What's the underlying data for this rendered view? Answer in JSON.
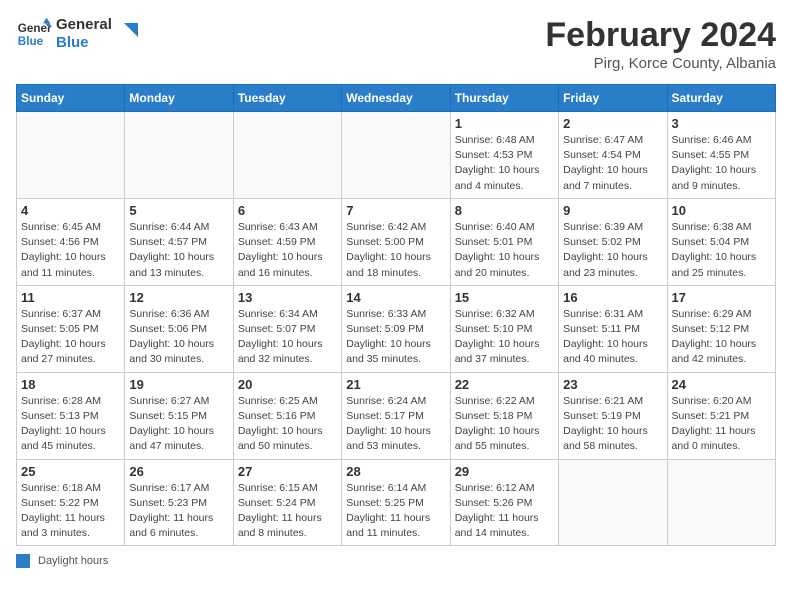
{
  "header": {
    "logo_general": "General",
    "logo_blue": "Blue",
    "month_title": "February 2024",
    "location": "Pirg, Korce County, Albania"
  },
  "weekdays": [
    "Sunday",
    "Monday",
    "Tuesday",
    "Wednesday",
    "Thursday",
    "Friday",
    "Saturday"
  ],
  "weeks": [
    [
      {
        "day": "",
        "info": ""
      },
      {
        "day": "",
        "info": ""
      },
      {
        "day": "",
        "info": ""
      },
      {
        "day": "",
        "info": ""
      },
      {
        "day": "1",
        "info": "Sunrise: 6:48 AM\nSunset: 4:53 PM\nDaylight: 10 hours and 4 minutes."
      },
      {
        "day": "2",
        "info": "Sunrise: 6:47 AM\nSunset: 4:54 PM\nDaylight: 10 hours and 7 minutes."
      },
      {
        "day": "3",
        "info": "Sunrise: 6:46 AM\nSunset: 4:55 PM\nDaylight: 10 hours and 9 minutes."
      }
    ],
    [
      {
        "day": "4",
        "info": "Sunrise: 6:45 AM\nSunset: 4:56 PM\nDaylight: 10 hours and 11 minutes."
      },
      {
        "day": "5",
        "info": "Sunrise: 6:44 AM\nSunset: 4:57 PM\nDaylight: 10 hours and 13 minutes."
      },
      {
        "day": "6",
        "info": "Sunrise: 6:43 AM\nSunset: 4:59 PM\nDaylight: 10 hours and 16 minutes."
      },
      {
        "day": "7",
        "info": "Sunrise: 6:42 AM\nSunset: 5:00 PM\nDaylight: 10 hours and 18 minutes."
      },
      {
        "day": "8",
        "info": "Sunrise: 6:40 AM\nSunset: 5:01 PM\nDaylight: 10 hours and 20 minutes."
      },
      {
        "day": "9",
        "info": "Sunrise: 6:39 AM\nSunset: 5:02 PM\nDaylight: 10 hours and 23 minutes."
      },
      {
        "day": "10",
        "info": "Sunrise: 6:38 AM\nSunset: 5:04 PM\nDaylight: 10 hours and 25 minutes."
      }
    ],
    [
      {
        "day": "11",
        "info": "Sunrise: 6:37 AM\nSunset: 5:05 PM\nDaylight: 10 hours and 27 minutes."
      },
      {
        "day": "12",
        "info": "Sunrise: 6:36 AM\nSunset: 5:06 PM\nDaylight: 10 hours and 30 minutes."
      },
      {
        "day": "13",
        "info": "Sunrise: 6:34 AM\nSunset: 5:07 PM\nDaylight: 10 hours and 32 minutes."
      },
      {
        "day": "14",
        "info": "Sunrise: 6:33 AM\nSunset: 5:09 PM\nDaylight: 10 hours and 35 minutes."
      },
      {
        "day": "15",
        "info": "Sunrise: 6:32 AM\nSunset: 5:10 PM\nDaylight: 10 hours and 37 minutes."
      },
      {
        "day": "16",
        "info": "Sunrise: 6:31 AM\nSunset: 5:11 PM\nDaylight: 10 hours and 40 minutes."
      },
      {
        "day": "17",
        "info": "Sunrise: 6:29 AM\nSunset: 5:12 PM\nDaylight: 10 hours and 42 minutes."
      }
    ],
    [
      {
        "day": "18",
        "info": "Sunrise: 6:28 AM\nSunset: 5:13 PM\nDaylight: 10 hours and 45 minutes."
      },
      {
        "day": "19",
        "info": "Sunrise: 6:27 AM\nSunset: 5:15 PM\nDaylight: 10 hours and 47 minutes."
      },
      {
        "day": "20",
        "info": "Sunrise: 6:25 AM\nSunset: 5:16 PM\nDaylight: 10 hours and 50 minutes."
      },
      {
        "day": "21",
        "info": "Sunrise: 6:24 AM\nSunset: 5:17 PM\nDaylight: 10 hours and 53 minutes."
      },
      {
        "day": "22",
        "info": "Sunrise: 6:22 AM\nSunset: 5:18 PM\nDaylight: 10 hours and 55 minutes."
      },
      {
        "day": "23",
        "info": "Sunrise: 6:21 AM\nSunset: 5:19 PM\nDaylight: 10 hours and 58 minutes."
      },
      {
        "day": "24",
        "info": "Sunrise: 6:20 AM\nSunset: 5:21 PM\nDaylight: 11 hours and 0 minutes."
      }
    ],
    [
      {
        "day": "25",
        "info": "Sunrise: 6:18 AM\nSunset: 5:22 PM\nDaylight: 11 hours and 3 minutes."
      },
      {
        "day": "26",
        "info": "Sunrise: 6:17 AM\nSunset: 5:23 PM\nDaylight: 11 hours and 6 minutes."
      },
      {
        "day": "27",
        "info": "Sunrise: 6:15 AM\nSunset: 5:24 PM\nDaylight: 11 hours and 8 minutes."
      },
      {
        "day": "28",
        "info": "Sunrise: 6:14 AM\nSunset: 5:25 PM\nDaylight: 11 hours and 11 minutes."
      },
      {
        "day": "29",
        "info": "Sunrise: 6:12 AM\nSunset: 5:26 PM\nDaylight: 11 hours and 14 minutes."
      },
      {
        "day": "",
        "info": ""
      },
      {
        "day": "",
        "info": ""
      }
    ]
  ],
  "footer": {
    "legend_label": "Daylight hours"
  }
}
